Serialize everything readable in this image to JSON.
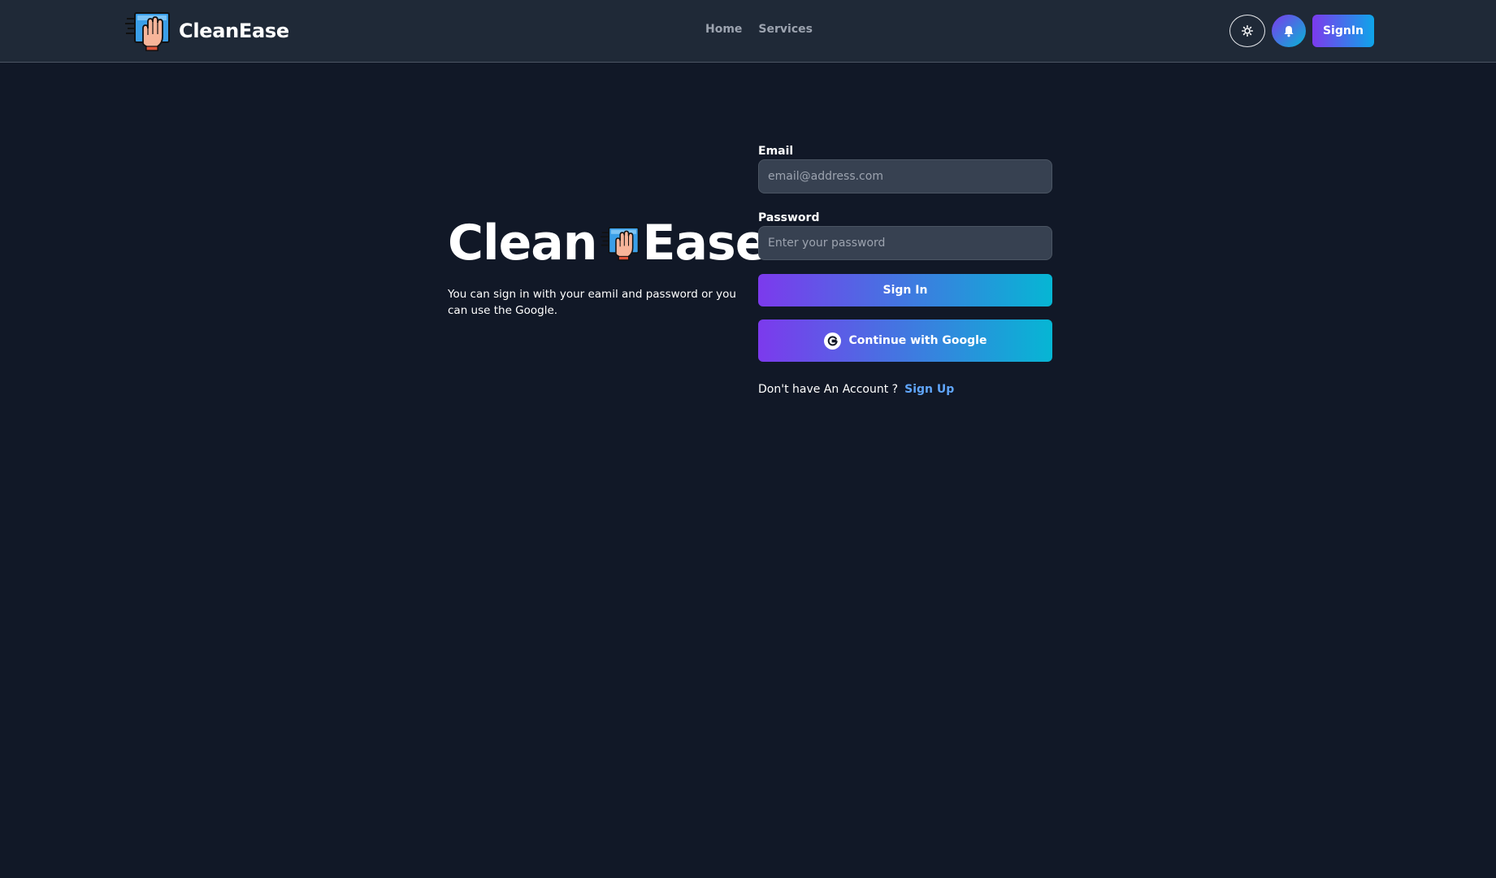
{
  "nav": {
    "brand": "CleanEase",
    "links": [
      {
        "label": "Home"
      },
      {
        "label": "Services"
      }
    ],
    "theme_icon": "sun-icon",
    "bell_icon": "bell-icon",
    "signin_label": "SignIn"
  },
  "hero": {
    "title_part1": "Clean",
    "title_part2": "Ease",
    "description": "You can sign in with your eamil and password or you can use the Google."
  },
  "form": {
    "email_label": "Email",
    "email_placeholder": "email@address.com",
    "password_label": "Password",
    "password_placeholder": "Enter your password",
    "signin_button": "Sign In",
    "google_button": "Continue with Google",
    "no_account_text": "Don't have An Account ?",
    "signup_link": "Sign Up"
  },
  "colors": {
    "background": "#111827",
    "navbar": "#1f2937",
    "input_bg": "#374151",
    "gradient_start": "#7c3aed",
    "gradient_end": "#06b6d4",
    "link": "#60a5fa"
  }
}
